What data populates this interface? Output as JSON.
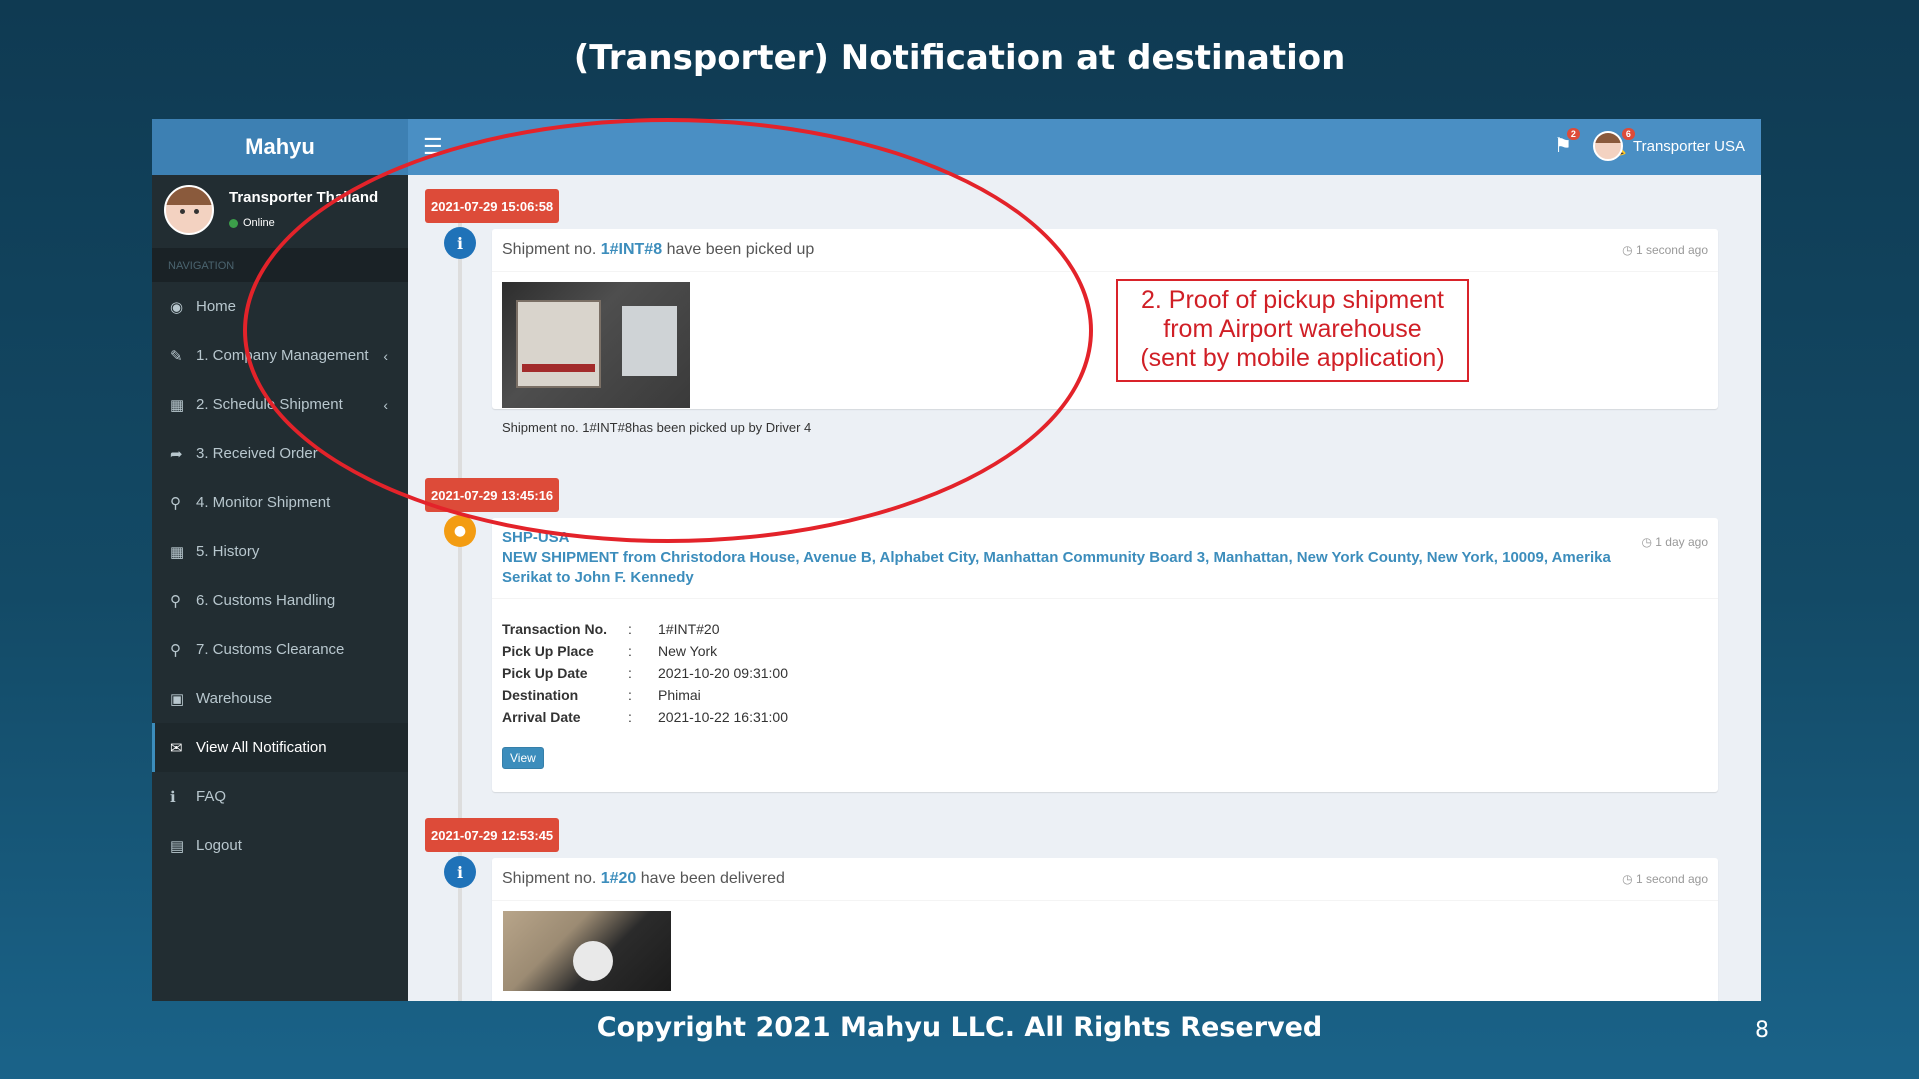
{
  "slide": {
    "title": "(Transporter) Notification at destination",
    "footer": "Copyright 2021 Mahyu LLC. All Rights Reserved",
    "page_number": "8"
  },
  "header": {
    "brand": "Mahyu",
    "flag_badge": "2",
    "bell_badge": "6",
    "user_name": "Transporter USA"
  },
  "sidebar": {
    "user_name": "Transporter Thailand",
    "user_status": "Online",
    "nav_header": "NAVIGATION",
    "items": [
      {
        "label": "Home",
        "icon": "dashboard-icon"
      },
      {
        "label": "1. Company Management",
        "icon": "edit-icon"
      },
      {
        "label": "2. Schedule Shipment",
        "icon": "calendar-icon"
      },
      {
        "label": "3. Received Order",
        "icon": "share-arrow-icon"
      },
      {
        "label": "4. Monitor Shipment",
        "icon": "search-icon"
      },
      {
        "label": "5. History",
        "icon": "calendar-icon"
      },
      {
        "label": "6. Customs Handling",
        "icon": "search-icon"
      },
      {
        "label": "7. Customs Clearance",
        "icon": "search-icon"
      },
      {
        "label": "Warehouse",
        "icon": "warehouse-icon"
      },
      {
        "label": "View All Notification",
        "icon": "envelope-icon"
      },
      {
        "label": "FAQ",
        "icon": "info-icon"
      },
      {
        "label": "Logout",
        "icon": "book-icon"
      }
    ],
    "active_item": "View All Notification"
  },
  "timeline": {
    "t1": {
      "date": "2021-07-29 15:06:58",
      "prefix": "Shipment no.",
      "shipment": "1#INT#8",
      "suffix": "have been picked up",
      "time_ago": "1 second ago",
      "caption": "Shipment no. 1#INT#8has been picked up by Driver 4"
    },
    "t2": {
      "date": "2021-07-29 13:45:16",
      "sender": "SHP-USA",
      "message": "NEW SHIPMENT from Christodora House, Avenue B, Alphabet City, Manhattan Community Board 3, Manhattan, New York County, New York, 10009, Amerika Serikat to John F. Kennedy",
      "time_ago": "1 day ago",
      "details": [
        {
          "key": "Transaction No.",
          "value": "1#INT#20"
        },
        {
          "key": "Pick Up Place",
          "value": "New York"
        },
        {
          "key": "Pick Up Date",
          "value": "2021-10-20 09:31:00"
        },
        {
          "key": "Destination",
          "value": "Phimai"
        },
        {
          "key": "Arrival Date",
          "value": "2021-10-22 16:31:00"
        }
      ],
      "separator": ":",
      "view_label": "View"
    },
    "t3": {
      "date": "2021-07-29 12:53:45",
      "prefix": "Shipment no.",
      "shipment": "1#20",
      "suffix": "have been delivered",
      "time_ago": "1 second ago"
    }
  },
  "annotation": {
    "line1": "2. Proof of pickup shipment",
    "line2": "from Airport warehouse",
    "line3": "(sent by mobile application)",
    "color": "#d01f26"
  }
}
